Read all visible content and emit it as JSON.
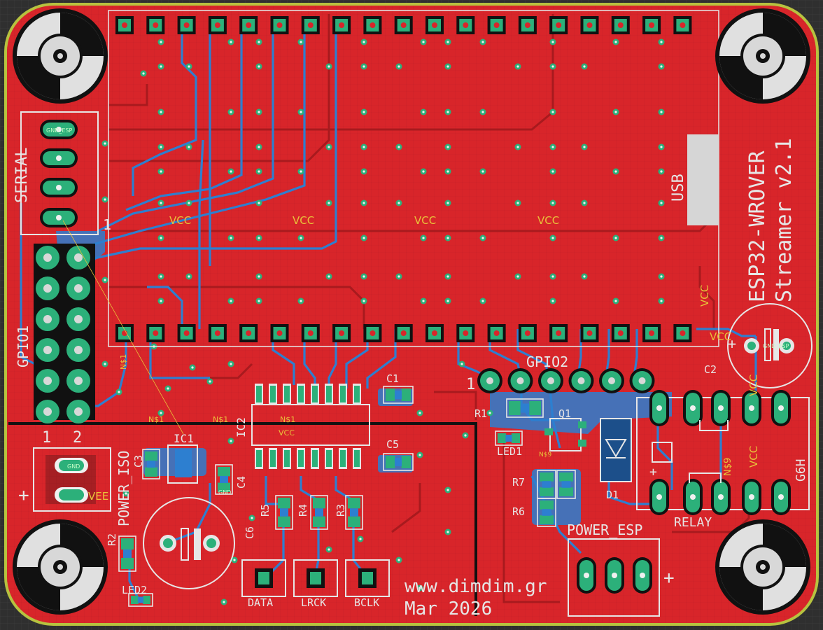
{
  "board": {
    "title": "ESP32-WROVER",
    "subtitle": "Streamer v2.1",
    "website": "www.dimdim.gr",
    "date": "Mar 2026",
    "colors": {
      "background": "#2f2f2f",
      "copper_top": "#d8252a",
      "copper_dark": "#a81a1e",
      "trace_bottom": "#2d7fd0",
      "pad": "#2cb07a",
      "silkscreen": "#e6e6e6",
      "net_label": "#e8c23a",
      "outline": "#b7c23f"
    }
  },
  "labels": {
    "serial": "SERIAL",
    "gpio1": "GPIO1",
    "gpio2": "GPIO2",
    "usb": "USB",
    "vcc": "VCC",
    "vee": "VEE",
    "relay": "RELAY",
    "g6h": "G6H",
    "power_iso": "POWER_ISO",
    "power_esp": "POWER_ESP",
    "data": "DATA",
    "lrck": "LRCK",
    "bclk": "BCLK",
    "ic1": "IC1",
    "ic2": "IC2",
    "c1": "C1",
    "c2": "C2",
    "c3": "C3",
    "c4": "C4",
    "c5": "C5",
    "c6": "C6",
    "r1": "R1",
    "r2": "R2",
    "r3": "R3",
    "r4": "R4",
    "r5": "R5",
    "r6": "R6",
    "r7": "R7",
    "q1": "Q1",
    "d1": "D1",
    "led1": "LED1",
    "led2": "LED2",
    "pin1": "1",
    "pin2": "2",
    "net_n1": "N$1",
    "net_n9": "N$9",
    "gnd_esp": "GND_ESP",
    "gnd": "GND",
    "plus": "+"
  }
}
